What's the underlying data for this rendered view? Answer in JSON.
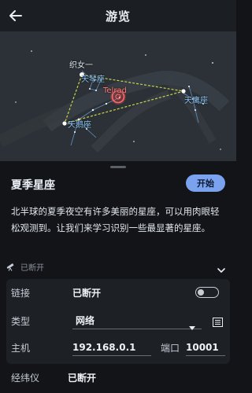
{
  "header": {
    "title": "游览"
  },
  "sky": {
    "labels": {
      "zhinv": "织女一",
      "tianqin": "天琴座",
      "telrad": "Telrad",
      "tianying": "天鹰座",
      "tiane": "天鹅座"
    }
  },
  "guide": {
    "title": "夏季星座",
    "start_label": "开始",
    "description": "北半球的夏季夜空有许多美丽的星座，可以用肉眼轻松观测到。让我们来学习识别一些最显著的星座。"
  },
  "connection": {
    "status_text": "已断开",
    "link_label": "链接",
    "link_value": "已断开",
    "type_label": "类型",
    "type_value": "网络",
    "host_label": "主机",
    "host_value": "192.168.0.1",
    "port_label": "端口",
    "port_value": "10001",
    "mount_label": "经纬仪",
    "mount_value": "已断开"
  },
  "colors": {
    "accent": "#7aa2ef",
    "constellation_line": "#c8d64a",
    "telrad": "#e05555"
  },
  "icons": {
    "back": "back-arrow-icon",
    "telescope": "telescope-icon",
    "chevron": "chevron-down-icon",
    "dropdown": "dropdown-arrow-icon",
    "list": "list-icon"
  }
}
